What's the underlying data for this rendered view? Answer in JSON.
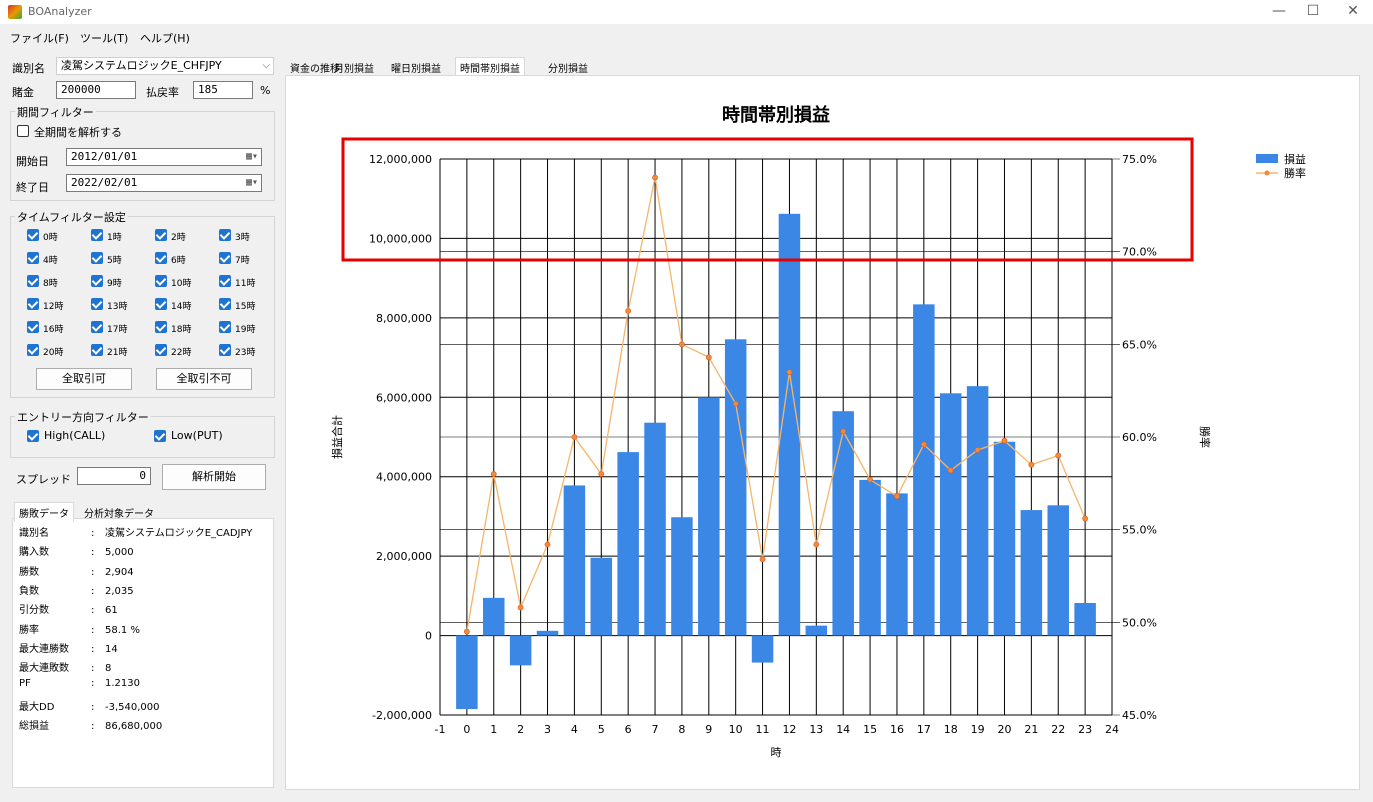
{
  "window": {
    "title": "BOAnalyzer"
  },
  "menu": [
    "ファイル(F)",
    "ツール(T)",
    "ヘルプ(H)"
  ],
  "controls": {
    "id_label": "識別名",
    "id_value": "凌駕システムロジックE_CHFJPY",
    "capital_label": "賭金",
    "capital_value": "200000",
    "payout_label": "払戻率",
    "payout_value": "185",
    "payout_unit": "%"
  },
  "period_filter": {
    "title": "期間フィルター",
    "all_label": "全期間を解析する",
    "start_label": "開始日",
    "start_value": "2012/01/01",
    "end_label": "終了日",
    "end_value": "2022/02/01"
  },
  "time_filter": {
    "title": "タイムフィルター設定",
    "hours": [
      "0時",
      "1時",
      "2時",
      "3時",
      "4時",
      "5時",
      "6時",
      "7時",
      "8時",
      "9時",
      "10時",
      "11時",
      "12時",
      "13時",
      "14時",
      "15時",
      "16時",
      "17時",
      "18時",
      "19時",
      "20時",
      "21時",
      "22時",
      "23時"
    ],
    "select_all": "全取引可",
    "select_none": "全取引不可"
  },
  "entry_filter": {
    "title": "エントリー方向フィルター",
    "high": "High(CALL)",
    "low": "Low(PUT)"
  },
  "spread": {
    "label": "スプレッド",
    "value": "0",
    "start_button": "解析開始"
  },
  "result_tabs": [
    "勝敗データ",
    "分析対象データ"
  ],
  "stats": [
    {
      "name": "識別名",
      "value": "凌駕システムロジックE_CADJPY"
    },
    {
      "name": "購入数",
      "value": "5,000"
    },
    {
      "name": "勝数",
      "value": "2,904"
    },
    {
      "name": "負数",
      "value": "2,035"
    },
    {
      "name": "引分数",
      "value": "61"
    },
    {
      "name": "勝率",
      "value": "58.1 %"
    },
    {
      "name": "最大連勝数",
      "value": "14"
    },
    {
      "name": "最大連敗数",
      "value": "8"
    },
    {
      "name": "PF",
      "value": "1.2130"
    },
    {
      "name": "最大DD",
      "value": "-3,540,000"
    },
    {
      "name": "総損益",
      "value": "86,680,000"
    }
  ],
  "chart_tabs": [
    "資金の推移",
    "月別損益",
    "曜日別損益",
    "時間帯別損益",
    "分別損益"
  ],
  "chart_data": {
    "type": "bar",
    "title": "時間帯別損益",
    "xlabel": "時",
    "ylabel": "損益合計",
    "y2label": "勝率",
    "xlim": [
      -1,
      24
    ],
    "ylim": [
      -2000000,
      12000000
    ],
    "y2lim": [
      45.0,
      75.0
    ],
    "x_ticks": [
      -1,
      0,
      1,
      2,
      3,
      4,
      5,
      6,
      7,
      8,
      9,
      10,
      11,
      12,
      13,
      14,
      15,
      16,
      17,
      18,
      19,
      20,
      21,
      22,
      23,
      24
    ],
    "y_ticks": [
      "-2,000,000",
      "0",
      "2,000,000",
      "4,000,000",
      "6,000,000",
      "8,000,000",
      "10,000,000",
      "12,000,000"
    ],
    "y2_ticks": [
      "45.0%",
      "50.0%",
      "55.0%",
      "60.0%",
      "65.0%",
      "70.0%",
      "75.0%"
    ],
    "categories": [
      0,
      1,
      2,
      3,
      4,
      5,
      6,
      7,
      8,
      9,
      10,
      11,
      12,
      13,
      14,
      15,
      16,
      17,
      18,
      19,
      20,
      21,
      22,
      23
    ],
    "series": [
      {
        "name": "損益",
        "axis": "left",
        "color": "#3a87e6",
        "values": [
          -1850000,
          950000,
          -750000,
          120000,
          3780000,
          1960000,
          4620000,
          5360000,
          2980000,
          6000000,
          7460000,
          -680000,
          10620000,
          250000,
          5650000,
          3920000,
          3580000,
          8340000,
          6100000,
          6280000,
          4880000,
          3160000,
          3280000,
          820000
        ]
      },
      {
        "name": "勝率",
        "axis": "right",
        "color": "#f5b56a",
        "values": [
          49.5,
          58.0,
          50.8,
          54.2,
          60.0,
          58.0,
          66.8,
          74.0,
          65.0,
          64.3,
          61.8,
          53.4,
          63.5,
          54.2,
          60.3,
          57.7,
          56.8,
          59.6,
          58.2,
          59.3,
          59.8,
          58.5,
          59.0,
          55.6
        ]
      }
    ],
    "legend_position": "top-right"
  },
  "annotation": {
    "color": "#e60000"
  }
}
